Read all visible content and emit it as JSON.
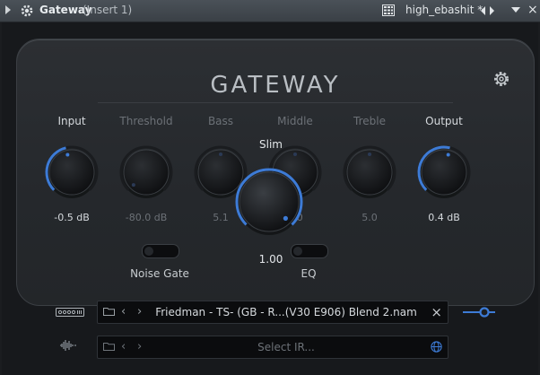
{
  "window": {
    "title": "Gateway",
    "subtitle": "(Insert 1)",
    "preset": "high_ebashit *"
  },
  "plugin": {
    "logo": "GATEWAY"
  },
  "knobs": [
    {
      "name": "input",
      "label": "Input",
      "value": "-0.5 dB",
      "active": true,
      "level": 0.45
    },
    {
      "name": "threshold",
      "label": "Threshold",
      "value": "-80.0 dB",
      "active": false,
      "level": 0.0
    },
    {
      "name": "bass",
      "label": "Bass",
      "value": "5.1",
      "active": false,
      "level": 0.5
    },
    {
      "name": "middle",
      "label": "Middle",
      "value": "5.0",
      "active": false,
      "level": 0.5
    },
    {
      "name": "treble",
      "label": "Treble",
      "value": "5.0",
      "active": false,
      "level": 0.5
    },
    {
      "name": "output",
      "label": "Output",
      "value": "0.4 dB",
      "active": true,
      "level": 0.55
    }
  ],
  "slim": {
    "label": "Slim",
    "value": "1.00",
    "level": 1.0
  },
  "toggles": {
    "noise_gate": "Noise Gate",
    "eq": "EQ"
  },
  "model_row": {
    "text": "Friedman - TS- (GB - R...(V30 E906) Blend 2.nam"
  },
  "ir_row": {
    "placeholder": "Select IR..."
  },
  "colors": {
    "accent": "#3d7bd6",
    "panel": "#2a2d31",
    "background": "#17191c"
  }
}
